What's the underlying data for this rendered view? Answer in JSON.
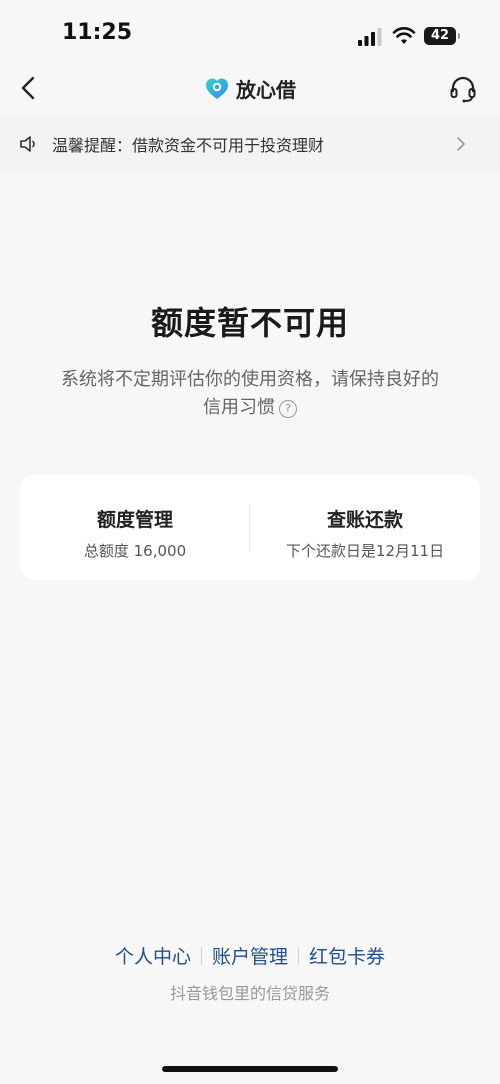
{
  "status_bar": {
    "time": "11:25",
    "battery": "42"
  },
  "nav": {
    "brand_name": "放心借",
    "icons": [
      "back-icon",
      "brand-logo-icon",
      "headset-icon"
    ]
  },
  "notice": {
    "text": "温馨提醒：借款资金不可用于投资理财",
    "icons": [
      "speaker-icon",
      "chevron-right-icon"
    ]
  },
  "status": {
    "title": "额度暂不可用",
    "description": "系统将不定期评估你的使用资格，请保持良好的信用习惯",
    "help_symbol": "?"
  },
  "card": {
    "left_title": "额度管理",
    "left_sub": "总额度 16,000",
    "right_title": "查账还款",
    "right_sub": "下个还款日是12月11日"
  },
  "footer": {
    "links": [
      "个人中心",
      "账户管理",
      "红包卡券"
    ],
    "note": "抖音钱包里的信贷服务"
  },
  "colors": {
    "background": "#f7f7f7",
    "link": "#1f4f8c",
    "logo_blue": "#2aa8f2"
  }
}
